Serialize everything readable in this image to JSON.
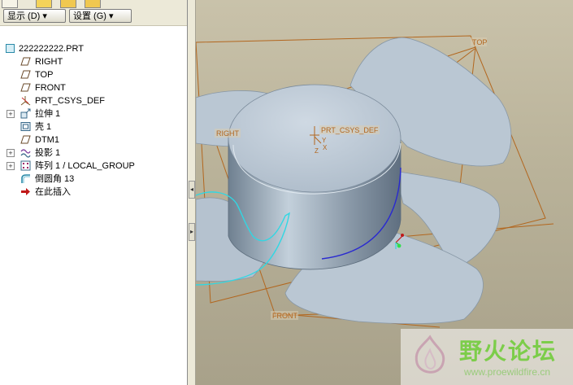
{
  "toolbar": {
    "show_label": "显示 (D) ▾",
    "settings_label": "设置 (G) ▾"
  },
  "tree": {
    "root": "222222222.PRT",
    "items": [
      {
        "label": "RIGHT",
        "icon": "datum-plane-icon"
      },
      {
        "label": "TOP",
        "icon": "datum-plane-icon"
      },
      {
        "label": "FRONT",
        "icon": "datum-plane-icon"
      },
      {
        "label": "PRT_CSYS_DEF",
        "icon": "csys-icon"
      },
      {
        "label": "拉伸 1",
        "icon": "extrude-icon",
        "expandable": true
      },
      {
        "label": "壳 1",
        "icon": "shell-icon"
      },
      {
        "label": "DTM1",
        "icon": "datum-plane-icon"
      },
      {
        "label": "投影 1",
        "icon": "projection-icon",
        "expandable": true
      },
      {
        "label": "阵列 1 / LOCAL_GROUP",
        "icon": "pattern-icon",
        "expandable": true
      },
      {
        "label": "倒圆角 13",
        "icon": "round-icon"
      },
      {
        "label": "在此插入",
        "icon": "insert-here-arrow-icon"
      }
    ]
  },
  "viewport": {
    "labels": {
      "top": "TOP",
      "right": "RIGHT",
      "front": "FRONT",
      "csys": "PRT_CSYS_DEF",
      "axis_x": "X",
      "axis_y": "Y",
      "axis_z": "Z"
    },
    "colors": {
      "background": "#bdb69e",
      "part_surface": "#b9c6d2",
      "datum": "#b2661e",
      "selection": "#31d7e3",
      "edge_highlight": "#2a2ad0"
    }
  },
  "watermark": {
    "title": "野火论坛",
    "url": "www.proewildfire.cn"
  }
}
